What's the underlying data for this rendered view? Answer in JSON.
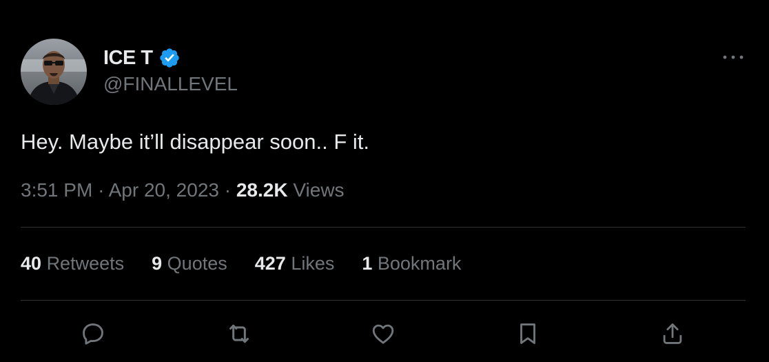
{
  "user": {
    "display_name": "ICE T",
    "handle": "@FINALLEVEL",
    "verified_color": "#1d9bf0",
    "avatar_alt": "profile-photo"
  },
  "tweet": {
    "text": "Hey. Maybe it’ll disappear soon.. F it."
  },
  "meta": {
    "time": "3:51 PM",
    "separator": "·",
    "date": "Apr 20, 2023",
    "views_count": "28.2K",
    "views_label": "Views"
  },
  "stats": {
    "retweets_count": "40",
    "retweets_label": "Retweets",
    "quotes_count": "9",
    "quotes_label": "Quotes",
    "likes_count": "427",
    "likes_label": "Likes",
    "bookmarks_count": "1",
    "bookmarks_label": "Bookmark"
  },
  "actions": [
    {
      "icon": "reply-icon"
    },
    {
      "icon": "retweet-icon"
    },
    {
      "icon": "like-icon"
    },
    {
      "icon": "bookmark-icon"
    },
    {
      "icon": "share-icon"
    }
  ],
  "colors": {
    "background": "#000000",
    "primary_text": "#e7e9ea",
    "secondary_text": "#71767b",
    "divider": "#2f3336",
    "verified_blue": "#1d9bf0"
  }
}
